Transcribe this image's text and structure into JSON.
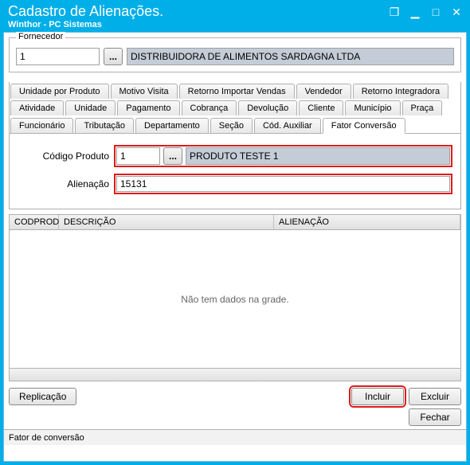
{
  "window": {
    "title": "Cadastro de Alienações.",
    "subtitle": "Winthor - PC Sistemas"
  },
  "fornecedor": {
    "label": "Fornecedor",
    "code": "1",
    "name": "DISTRIBUIDORA DE ALIMENTOS SARDAGNA LTDA"
  },
  "tabs": {
    "row1": [
      "Unidade por Produto",
      "Motivo Visita",
      "Retorno Importar Vendas",
      "Vendedor",
      "Retorno Integradora"
    ],
    "row2": [
      "Atividade",
      "Unidade",
      "Pagamento",
      "Cobrança",
      "Devolução",
      "Cliente",
      "Município",
      "Praça"
    ],
    "row3": [
      "Funcionário",
      "Tributação",
      "Departamento",
      "Seção",
      "Cód. Auxiliar",
      "Fator Conversão"
    ],
    "active": "Fator Conversão"
  },
  "form": {
    "codigo_label": "Código Produto",
    "codigo_value": "1",
    "produto_desc": "PRODUTO TESTE 1",
    "alien_label": "Alienação",
    "alien_value": "15131",
    "lookup": "..."
  },
  "grid": {
    "columns": {
      "cod": "CODPROD",
      "desc": "DESCRIÇÃO",
      "alien": "ALIENAÇÃO"
    },
    "empty_text": "Não tem dados na grade."
  },
  "buttons": {
    "replicacao": "Replicação",
    "incluir": "Incluir",
    "excluir": "Excluir",
    "fechar": "Fechar"
  },
  "status": "Fator de conversão"
}
